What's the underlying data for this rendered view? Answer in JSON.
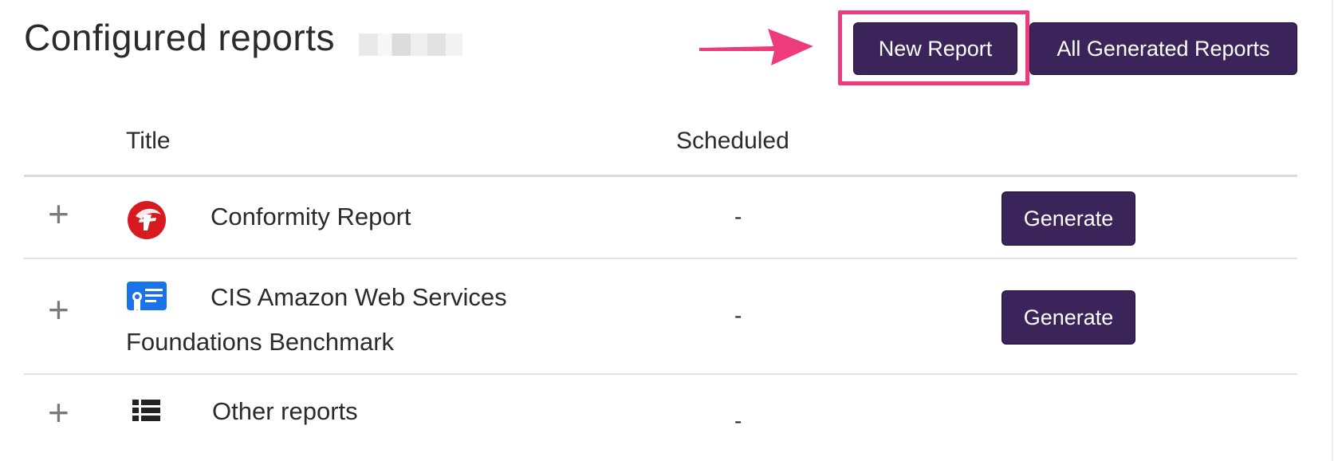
{
  "header": {
    "title": "Configured reports",
    "new_report_label": "New Report",
    "all_generated_label": "All Generated Reports"
  },
  "table": {
    "columns": [
      "Title",
      "Scheduled"
    ],
    "rows": [
      {
        "expand": "+",
        "icon": "trend-micro-logo-icon",
        "title": "Conformity Report",
        "scheduled": "-",
        "action": "Generate"
      },
      {
        "expand": "+",
        "icon": "certificate-icon",
        "title_line1": "CIS Amazon Web Services",
        "title_line2": "Foundations Benchmark",
        "scheduled": "-",
        "action": "Generate"
      },
      {
        "expand": "+",
        "icon": "list-icon",
        "title": "Other reports",
        "scheduled": "-"
      }
    ]
  },
  "colors": {
    "button_bg": "#3b2459",
    "highlight": "#ee3b7c",
    "arrow": "#ee3b7c",
    "logo_red": "#d71920",
    "cert_blue": "#1a73e8"
  }
}
